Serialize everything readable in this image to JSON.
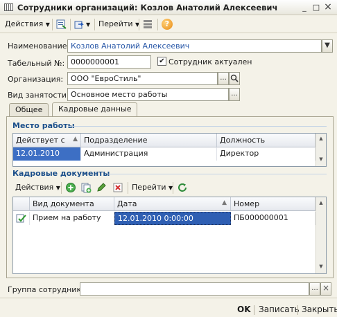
{
  "window": {
    "title": "Сотрудники организаций: Козлов Анатолий Алексеевич",
    "controls": {
      "minimize": "_",
      "maximize": "□",
      "close": "×"
    }
  },
  "toolbar": {
    "actions_label": "Действия",
    "goto_label": "Перейти",
    "help_icon": "?"
  },
  "form": {
    "name_label": "Наименование:",
    "name_value": "Козлов Анатолий Алексеевич",
    "tabnum_label": "Табельный №:",
    "tabnum_value": "0000000001",
    "active_label": "Сотрудник актуален",
    "active_checked": true,
    "org_label": "Организация:",
    "org_value": "ООО \"ЕвроСтиль\"",
    "employment_label": "Вид занятости:",
    "employment_value": "Основное место работы",
    "ellipsis": "...",
    "search_icon": "search-icon"
  },
  "tabs": [
    {
      "label": "Общее",
      "active": false
    },
    {
      "label": "Кадровые данные",
      "active": true
    }
  ],
  "workplace": {
    "title": "Место работы",
    "columns": [
      "Действует с",
      "Подразделение",
      "Должность"
    ],
    "rows": [
      {
        "date": "12.01.2010",
        "department": "Администрация",
        "position": "Директор"
      }
    ]
  },
  "hr_docs": {
    "title": "Кадровые документы",
    "actions_label": "Действия",
    "goto_label": "Перейти",
    "columns": [
      "Вид документа",
      "Дата",
      "Номер"
    ],
    "rows": [
      {
        "type": "Прием на работу",
        "date": "12.01.2010 0:00:00",
        "number": "ПБ000000001"
      }
    ]
  },
  "group": {
    "label": "Группа сотрудника:",
    "value": "",
    "ellipsis": "...",
    "clear": "×"
  },
  "footer": {
    "ok": "OK",
    "save": "Записать",
    "close": "Закрыть"
  },
  "colors": {
    "selection": "#2f5fb3",
    "selection_light": "#3d6fc4",
    "accent_text": "#1a4e8a"
  }
}
